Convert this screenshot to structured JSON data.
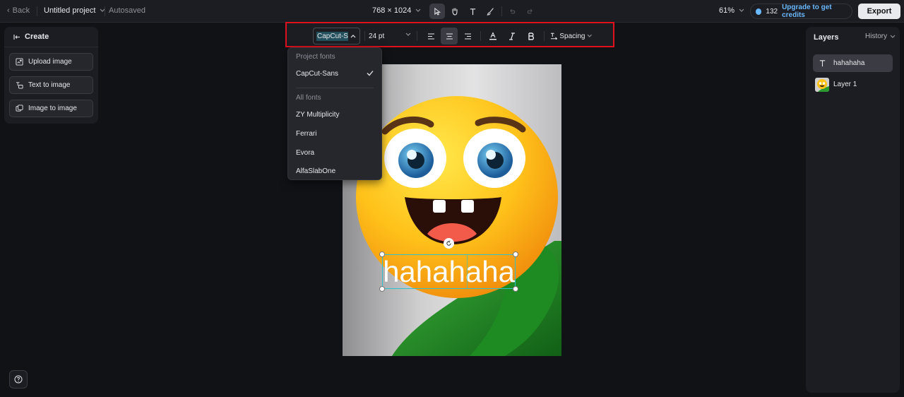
{
  "topbar": {
    "back_label": "Back",
    "project_name": "Untitled project",
    "autosaved": "Autosaved",
    "canvas_size": "768 × 1024",
    "zoom": "61%",
    "credits_count": "132",
    "upgrade_label": "Upgrade to get credits",
    "export_label": "Export"
  },
  "create_panel": {
    "title": "Create",
    "buttons": [
      {
        "label": "Upload image",
        "icon": "upload-image-icon"
      },
      {
        "label": "Text to image",
        "icon": "text-to-image-icon"
      },
      {
        "label": "Image to image",
        "icon": "image-to-image-icon"
      }
    ]
  },
  "text_toolbar": {
    "font": "CapCut-Sans",
    "size": "24 pt",
    "spacing_label": "Spacing",
    "align_selected": "center"
  },
  "font_dropdown": {
    "project_fonts_label": "Project fonts",
    "project_fonts": [
      "CapCut-Sans"
    ],
    "selected": "CapCut-Sans",
    "all_fonts_label": "All fonts",
    "all_fonts": [
      "ZY Multiplicity",
      "Ferrari",
      "Evora",
      "AlfaSlabOne"
    ]
  },
  "canvas": {
    "text": "hahahaha"
  },
  "layers": {
    "title": "Layers",
    "history_label": "History",
    "items": [
      {
        "name": "hahahaha",
        "type": "text"
      },
      {
        "name": "Layer 1",
        "type": "image"
      }
    ]
  },
  "colors": {
    "accent": "#6ab8ff",
    "highlight_box": "#e0101d",
    "selection": "#2fc2cc"
  }
}
